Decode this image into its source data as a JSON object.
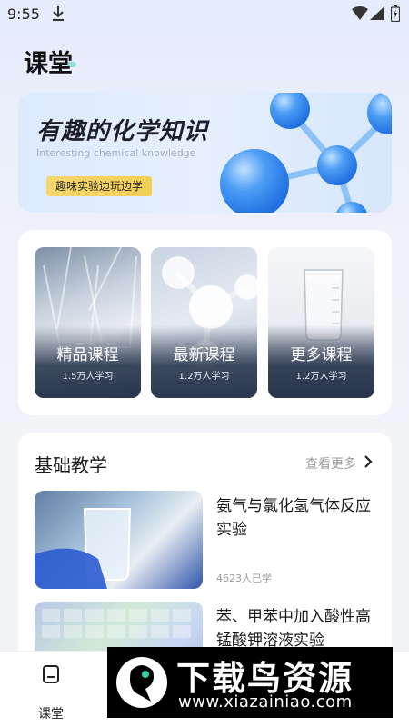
{
  "status_bar": {
    "time": "9:55",
    "icons": [
      "download-icon",
      "wifi-icon",
      "signal-icon",
      "battery-icon"
    ]
  },
  "page": {
    "title": "课堂"
  },
  "banner": {
    "title": "有趣的化学知识",
    "subtitle": "Interesting chemical knowledge",
    "tag": "趣味实验边玩边学"
  },
  "categories": [
    {
      "label": "精品课程",
      "count": "1.5万人学习"
    },
    {
      "label": "最新课程",
      "count": "1.2万人学习"
    },
    {
      "label": "更多课程",
      "count": "1.2万人学习"
    }
  ],
  "basic": {
    "title": "基础教学",
    "more": "查看更多",
    "lessons": [
      {
        "title": "氨气与氯化氢气体反应实验",
        "meta": "4623人已学"
      },
      {
        "title": "苯、甲苯中加入酸性高锰酸钾溶液实验",
        "meta": ""
      }
    ]
  },
  "nav": {
    "items": [
      {
        "label": "课堂",
        "icon": "book-icon"
      }
    ]
  },
  "watermark": {
    "name": "下载鸟资源",
    "url": "www.xiazainiao.com"
  },
  "colors": {
    "accent_blue": "#3d8cf0",
    "tag_yellow": "#f4d35e",
    "tile_overlay": "#233048"
  }
}
